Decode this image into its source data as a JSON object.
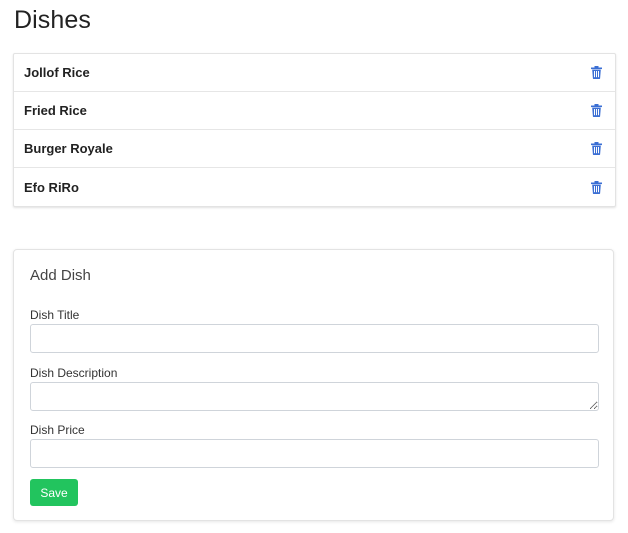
{
  "page": {
    "title": "Dishes"
  },
  "dishes": [
    {
      "name": "Jollof Rice"
    },
    {
      "name": "Fried Rice"
    },
    {
      "name": "Burger Royale"
    },
    {
      "name": "Efo RiRo"
    }
  ],
  "form": {
    "title": "Add Dish",
    "fields": {
      "title_label": "Dish Title",
      "title_value": "",
      "description_label": "Dish Description",
      "description_value": "",
      "price_label": "Dish Price",
      "price_value": ""
    },
    "save_label": "Save"
  },
  "icons": {
    "delete": "trash-icon"
  },
  "colors": {
    "trash_icon": "#3b6fd4",
    "save_button": "#22c45e"
  }
}
